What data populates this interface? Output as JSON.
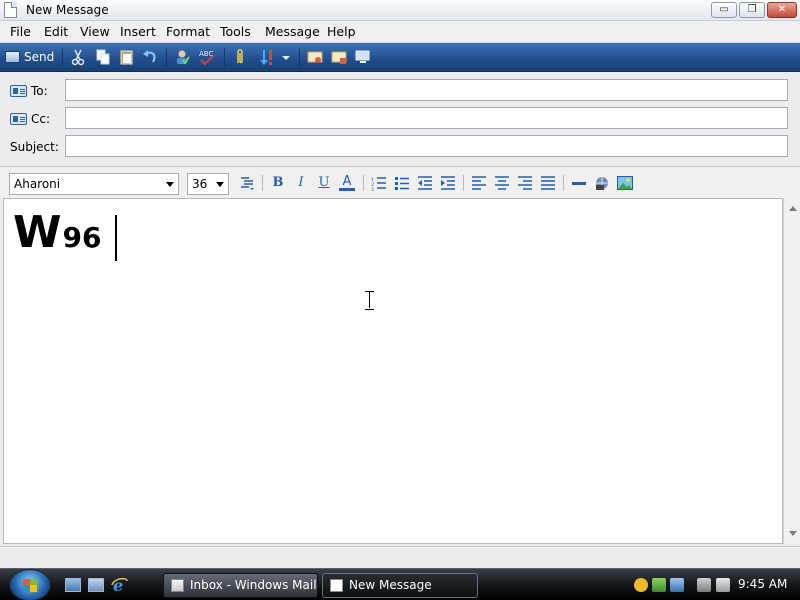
{
  "window": {
    "title": "New Message"
  },
  "window_controls": {
    "minimize": "▭",
    "maximize": "❐",
    "close": "✕"
  },
  "menu": [
    "File",
    "Edit",
    "View",
    "Insert",
    "Format",
    "Tools",
    "Message",
    "Help"
  ],
  "toolbar": {
    "send_label": "Send",
    "icons": [
      "cut-icon",
      "copy-icon",
      "paste-icon",
      "undo-icon",
      "check-names-icon",
      "spelling-icon",
      "attach-icon",
      "priority-icon",
      "sign-icon",
      "encrypt-icon",
      "work-offline-icon"
    ]
  },
  "headers": {
    "to_label": "To:",
    "cc_label": "Cc:",
    "subject_label": "Subject:",
    "to_value": "",
    "cc_value": "",
    "subject_value": ""
  },
  "format_bar": {
    "font": "Aharoni",
    "size": "36",
    "bold": "B",
    "italic": "I",
    "underline": "U",
    "font_color": "A"
  },
  "body": {
    "text_large": "W",
    "text_small": "96"
  },
  "taskbar": {
    "tasks": [
      "Inbox - Windows Mail",
      "New Message"
    ],
    "clock": "9:45 AM"
  },
  "colors": {
    "toolbar_blue": "#22508E",
    "format_icon_blue": "#1F5FB8",
    "taskbar_dark": "#14171B"
  }
}
